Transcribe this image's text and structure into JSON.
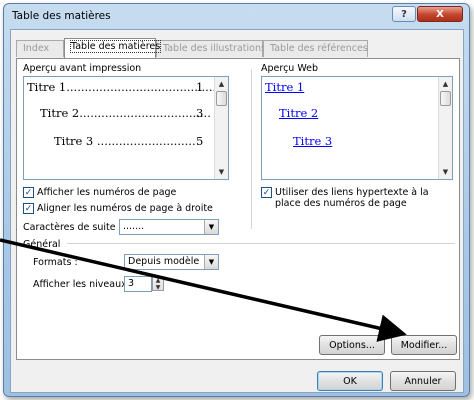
{
  "window": {
    "title": "Table des matières"
  },
  "tabs": [
    "Index",
    "Table des matières",
    "Table des illustrations",
    "Table des références"
  ],
  "print_preview": {
    "label": "Aperçu avant impression",
    "entries": [
      {
        "text": "Titre 1",
        "page": "1"
      },
      {
        "text": "Titre 2",
        "page": "3"
      },
      {
        "text": "Titre 3",
        "page": "5"
      }
    ]
  },
  "web_preview": {
    "label": "Aperçu Web",
    "links": [
      "Titre 1",
      "Titre 2",
      "Titre 3"
    ]
  },
  "options": {
    "show_page_numbers": {
      "label": "Afficher les numéros de page",
      "checked": true
    },
    "align_right": {
      "label": "Aligner les numéros de page à droite",
      "checked": true
    },
    "leader_label": "Caractères de suite :",
    "leader_value": ".......",
    "use_hyperlinks": {
      "label": "Utiliser des liens hypertexte à la place des numéros de page",
      "checked": true
    }
  },
  "general": {
    "label": "Général",
    "formats_label": "Formats :",
    "formats_value": "Depuis modèle",
    "levels_label": "Afficher les niveaux :",
    "levels_value": "3"
  },
  "buttons": {
    "options": "Options...",
    "modify": "Modifier...",
    "ok": "OK",
    "cancel": "Annuler"
  },
  "title_buttons": {
    "help": "?",
    "close": "X"
  }
}
